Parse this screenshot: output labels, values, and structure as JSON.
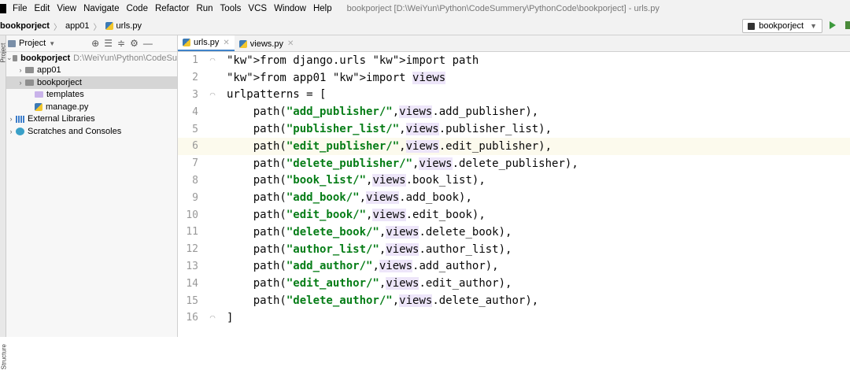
{
  "menubar": {
    "items": [
      {
        "label": "File"
      },
      {
        "label": "Edit"
      },
      {
        "label": "View"
      },
      {
        "label": "Navigate"
      },
      {
        "label": "Code"
      },
      {
        "label": "Refactor"
      },
      {
        "label": "Run"
      },
      {
        "label": "Tools"
      },
      {
        "label": "VCS"
      },
      {
        "label": "Window"
      },
      {
        "label": "Help"
      }
    ],
    "window_title": "bookporject [D:\\WeiYun\\Python\\CodeSummery\\PythonCode\\bookporject] - urls.py"
  },
  "navbar": {
    "breadcrumbs": [
      "bookporject",
      "app01",
      "urls.py"
    ],
    "run_config": "bookporject"
  },
  "side_strip": {
    "top_label": "Project",
    "bottom_label": "Structure"
  },
  "project_panel": {
    "title": "Project",
    "tree": [
      {
        "label": "bookporject",
        "path": "D:\\WeiYun\\Python\\CodeSu"
      },
      {
        "label": "app01"
      },
      {
        "label": "bookporject"
      },
      {
        "label": "templates"
      },
      {
        "label": "manage.py"
      },
      {
        "label": "External Libraries"
      },
      {
        "label": "Scratches and Consoles"
      }
    ]
  },
  "editor": {
    "tabs": [
      {
        "label": "urls.py"
      },
      {
        "label": "views.py"
      }
    ],
    "lines": [
      {
        "n": "1",
        "text": "from django.urls import path"
      },
      {
        "n": "2",
        "text": "from app01 import views"
      },
      {
        "n": "3",
        "text": "urlpatterns = ["
      },
      {
        "n": "4",
        "text": "    path(\"add_publisher/\",views.add_publisher),"
      },
      {
        "n": "5",
        "text": "    path(\"publisher_list/\",views.publisher_list),"
      },
      {
        "n": "6",
        "text": "    path(\"edit_publisher/\",views.edit_publisher),"
      },
      {
        "n": "7",
        "text": "    path(\"delete_publisher/\",views.delete_publisher),"
      },
      {
        "n": "8",
        "text": "    path(\"book_list/\",views.book_list),"
      },
      {
        "n": "9",
        "text": "    path(\"add_book/\",views.add_book),"
      },
      {
        "n": "10",
        "text": "    path(\"edit_book/\",views.edit_book),"
      },
      {
        "n": "11",
        "text": "    path(\"delete_book/\",views.delete_book),"
      },
      {
        "n": "12",
        "text": "    path(\"author_list/\",views.author_list),"
      },
      {
        "n": "13",
        "text": "    path(\"add_author/\",views.add_author),"
      },
      {
        "n": "14",
        "text": "    path(\"edit_author/\",views.edit_author),"
      },
      {
        "n": "15",
        "text": "    path(\"delete_author/\",views.delete_author),"
      },
      {
        "n": "16",
        "text": "]"
      }
    ]
  }
}
